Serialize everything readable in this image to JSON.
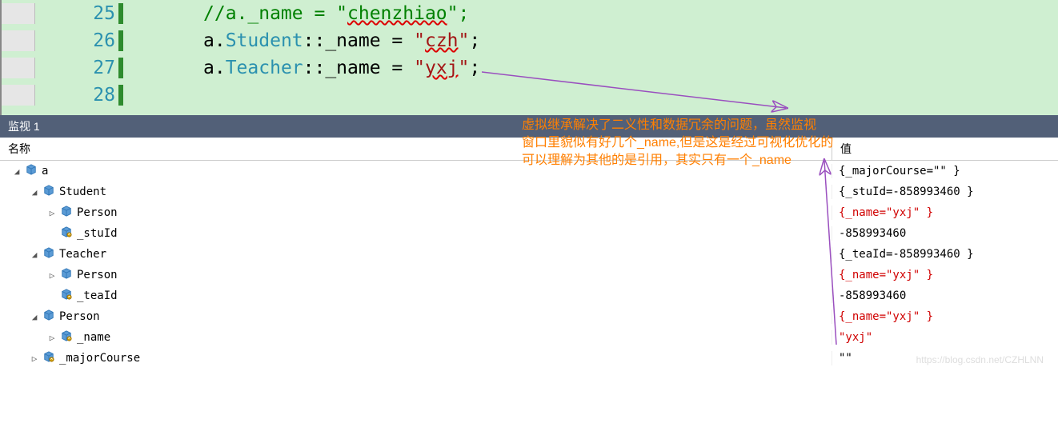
{
  "editor": {
    "lines": [
      {
        "num": "25",
        "indent": "",
        "tokens": [
          "comment",
          "//a._name = \"chenzhiao\";"
        ]
      },
      {
        "num": "26",
        "indent": "",
        "tokens": [
          "plain",
          "a.",
          "class",
          "Student",
          "plain",
          "::_name = ",
          "string",
          "\"czh\"",
          "plain",
          ";"
        ]
      },
      {
        "num": "27",
        "indent": "",
        "tokens": [
          "plain",
          "a.",
          "class",
          "Teacher",
          "plain",
          "::_name = ",
          "string",
          "\"yxj\"",
          "plain",
          ";"
        ]
      },
      {
        "num": "28",
        "indent": "",
        "tokens": []
      }
    ]
  },
  "annotation": {
    "line1": "虚拟继承解决了二义性和数据冗余的问题，虽然监视",
    "line2": "窗口里貌似有好几个_name,但是这是经过可视化优化的",
    "line3": "可以理解为其他的是引用，其实只有一个_name"
  },
  "watch": {
    "title": "监视 1",
    "headers": {
      "name": "名称",
      "value": "值"
    },
    "rows": [
      {
        "indent": 0,
        "exp": "down",
        "icon": "cube",
        "name": "a",
        "value": "{_majorCourse=\"\" }",
        "red": false
      },
      {
        "indent": 1,
        "exp": "down",
        "icon": "cube",
        "name": "Student",
        "value": "{_stuId=-858993460 }",
        "red": false
      },
      {
        "indent": 2,
        "exp": "right",
        "icon": "cube",
        "name": "Person",
        "value": "{_name=\"yxj\" }",
        "red": true
      },
      {
        "indent": 2,
        "exp": "none",
        "icon": "field",
        "name": "_stuId",
        "value": "-858993460",
        "red": false
      },
      {
        "indent": 1,
        "exp": "down",
        "icon": "cube",
        "name": "Teacher",
        "value": "{_teaId=-858993460 }",
        "red": false
      },
      {
        "indent": 2,
        "exp": "right",
        "icon": "cube",
        "name": "Person",
        "value": "{_name=\"yxj\" }",
        "red": true
      },
      {
        "indent": 2,
        "exp": "none",
        "icon": "field",
        "name": "_teaId",
        "value": "-858993460",
        "red": false
      },
      {
        "indent": 1,
        "exp": "down",
        "icon": "cube",
        "name": "Person",
        "value": "{_name=\"yxj\" }",
        "red": true
      },
      {
        "indent": 2,
        "exp": "right",
        "icon": "field",
        "name": "_name",
        "value": "\"yxj\"",
        "red": true
      },
      {
        "indent": 1,
        "exp": "right",
        "icon": "field",
        "name": "_majorCourse",
        "value": "\"\"",
        "red": false
      }
    ]
  },
  "watermark": "https://blog.csdn.net/CZHLNN"
}
